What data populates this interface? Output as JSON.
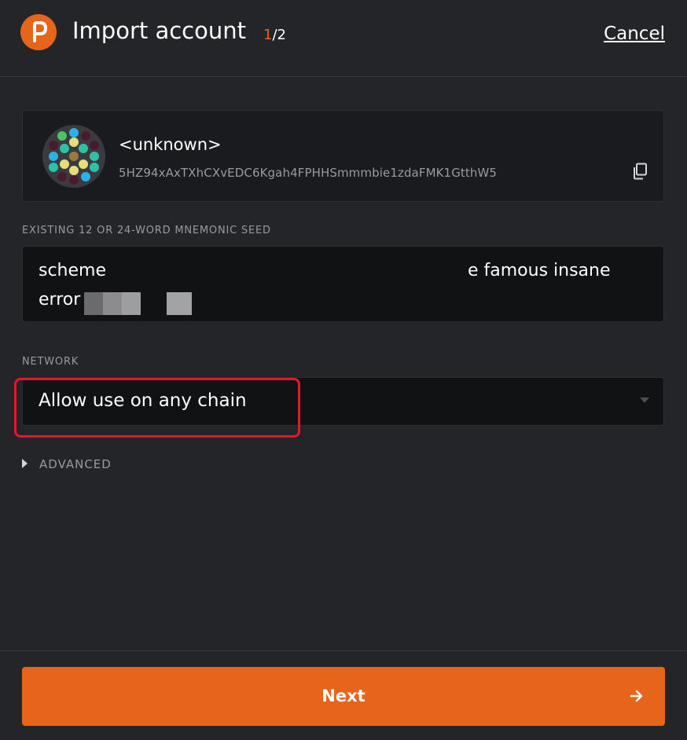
{
  "header": {
    "title": "Import account",
    "step_current": "1",
    "step_total": "/2",
    "cancel_label": "Cancel",
    "logo_icon": "polkadot-logo-icon",
    "brand_color": "#e6651b"
  },
  "account": {
    "name": "<unknown>",
    "address": "5HZ94xAxTXhCXvEDC6Kgah4FPHHSmmmbie1zdaFMK1GtthW5",
    "identicon": "identicon",
    "copy_icon": "copy-icon"
  },
  "seed": {
    "label": "EXISTING 12 OR 24-WORD MNEMONIC SEED",
    "visible_start": "scheme",
    "visible_end": "e famous insane",
    "line2_start": "error"
  },
  "network": {
    "label": "NETWORK",
    "selected": "Allow use on any chain"
  },
  "advanced": {
    "label": "ADVANCED"
  },
  "footer": {
    "next_label": "Next",
    "next_icon": "arrow-right-icon"
  }
}
